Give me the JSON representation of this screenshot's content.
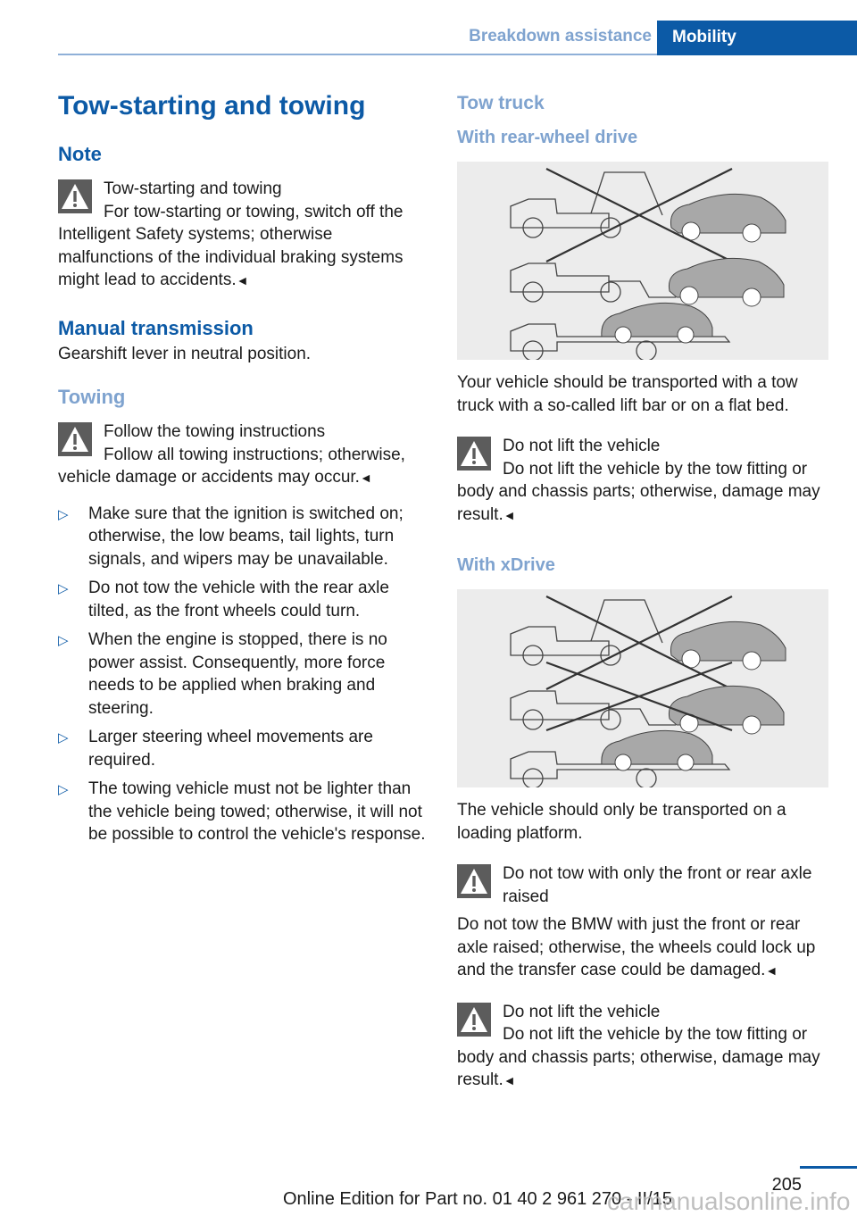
{
  "header": {
    "section": "Breakdown assistance",
    "chapter_tab": "Mobility"
  },
  "left": {
    "title": "Tow-starting and towing",
    "note_heading": "Note",
    "note_warning": {
      "icon": "warning-triangle-icon",
      "title": "Tow-starting and towing",
      "body": "For tow-starting or towing, switch off the Intelligent Safety systems; otherwise malfunctions of the individual braking systems might lead to accidents.",
      "end": "◄"
    },
    "manual_heading": "Manual transmission",
    "manual_text": "Gearshift lever in neutral position.",
    "towing_heading": "Towing",
    "towing_warning": {
      "icon": "warning-triangle-icon",
      "title": "Follow the towing instructions",
      "body": "Follow all towing instructions; otherwise, vehicle damage or accidents may occur.",
      "end": "◄"
    },
    "bullet_glyph": "▷",
    "bullets": [
      "Make sure that the ignition is switched on; otherwise, the low beams, tail lights, turn signals, and wipers may be unavailable.",
      "Do not tow the vehicle with the rear axle tilted, as the front wheels could turn.",
      "When the engine is stopped, there is no power assist. Consequently, more force needs to be applied when braking and steering.",
      "Larger steering wheel movements are required.",
      "The towing vehicle must not be lighter than the vehicle being towed; otherwise, it will not be possible to control the vehicle's response."
    ]
  },
  "right": {
    "title": "Tow truck",
    "rwd_heading": "With rear-wheel drive",
    "rwd_figure": "Illustration: tow truck methods — hook lift crossed out, lift bar allowed, flat bed allowed",
    "rwd_text": "Your vehicle should be transported with a tow truck with a so-called lift bar or on a flat bed.",
    "rwd_warning": {
      "icon": "warning-triangle-icon",
      "title": "Do not lift the vehicle",
      "body": "Do not lift the vehicle by the tow fitting or body and chassis parts; otherwise, damage may result.",
      "end": "◄"
    },
    "xdrive_heading": "With xDrive",
    "xdrive_figure": "Illustration: tow truck methods — hook lift and lift bar crossed out, flat bed allowed",
    "xdrive_text": "The vehicle should only be transported on a loading platform.",
    "xdrive_warning1": {
      "icon": "warning-triangle-icon",
      "title": "Do not tow with only the front or rear axle raised",
      "body": "Do not tow the BMW with just the front or rear axle raised; otherwise, the wheels could lock up and the transfer case could be damaged.",
      "end": "◄"
    },
    "xdrive_warning2": {
      "icon": "warning-triangle-icon",
      "title": "Do not lift the vehicle",
      "body": "Do not lift the vehicle by the tow fitting or body and chassis parts; otherwise, damage may result.",
      "end": "◄"
    }
  },
  "footer": {
    "page_number": "205",
    "edition": "Online Edition for Part no. 01 40 2 961 270 - II/15",
    "watermark": "carmanualsonline.info"
  },
  "colors": {
    "brand_blue": "#0c5aa6",
    "light_blue": "#7fa3cf",
    "warning_gray": "#5c5c5c",
    "figure_bg": "#ececec"
  }
}
